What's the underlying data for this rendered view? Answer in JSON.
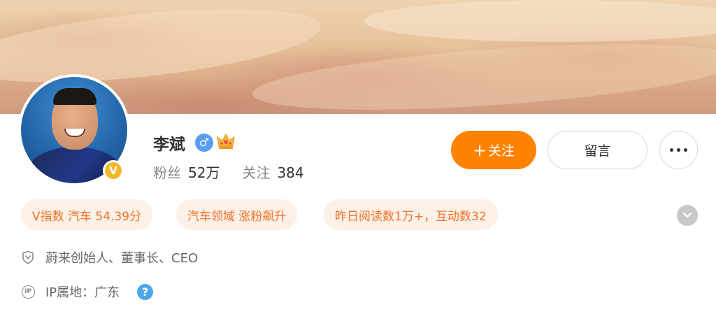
{
  "profile": {
    "name": "李斌",
    "verified_badge": "V",
    "gender_icon": "male-icon",
    "crown_icon": "crown-icon",
    "stats": {
      "followers_label": "粉丝",
      "followers_value": "52万",
      "following_label": "关注",
      "following_value": "384"
    }
  },
  "actions": {
    "follow_label": "关注",
    "follow_plus": "+",
    "message_label": "留言",
    "more_icon": "more-icon"
  },
  "tags": [
    "V指数 汽车 54.39分",
    "汽车领域 涨粉飙升",
    "昨日阅读数1万+，互动数32"
  ],
  "info": {
    "title": "蔚来创始人、董事长、CEO",
    "ip_icon_text": "IP",
    "ip_location": "IP属地：广东",
    "help_icon_text": "?"
  },
  "colors": {
    "accent": "#ff8200",
    "tag_text": "#f0742a",
    "tag_bg": "#fdf0e6",
    "verified": "#f5b82a",
    "gender": "#5a9ef0",
    "help": "#4aa8e8"
  }
}
